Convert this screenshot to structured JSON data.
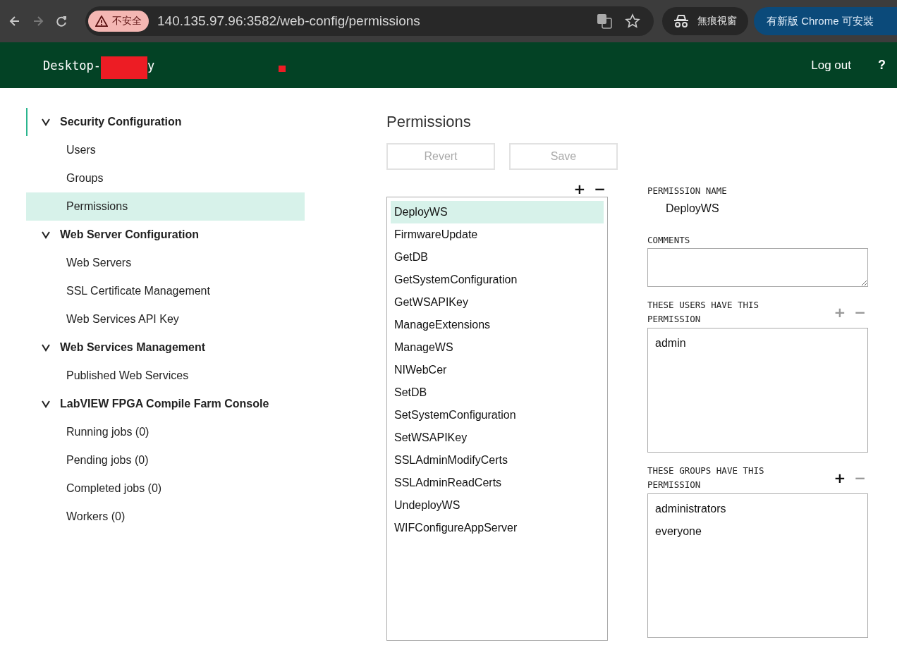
{
  "browser": {
    "security_chip": "不安全",
    "url": "140.135.97.96:3582/web-config/permissions",
    "incognito": "無痕視窗",
    "update": "有新版 Chrome 可安裝"
  },
  "header": {
    "host_prefix": "Desktop-",
    "host_suffix": "y",
    "logout": "Log out",
    "help": "?"
  },
  "sidebar": [
    {
      "label": "Security Configuration",
      "expanded": true,
      "focused": true,
      "children": [
        {
          "label": "Users",
          "selected": false
        },
        {
          "label": "Groups",
          "selected": false
        },
        {
          "label": "Permissions",
          "selected": true
        }
      ]
    },
    {
      "label": "Web Server Configuration",
      "expanded": true,
      "focused": false,
      "children": [
        {
          "label": "Web Servers",
          "selected": false
        },
        {
          "label": "SSL Certificate Management",
          "selected": false
        },
        {
          "label": "Web Services API Key",
          "selected": false
        }
      ]
    },
    {
      "label": "Web Services Management",
      "expanded": true,
      "focused": false,
      "children": [
        {
          "label": "Published Web Services",
          "selected": false
        }
      ]
    },
    {
      "label": "LabVIEW FPGA Compile Farm Console",
      "expanded": true,
      "focused": false,
      "children": [
        {
          "label": "Running jobs (0)",
          "selected": false
        },
        {
          "label": "Pending jobs (0)",
          "selected": false
        },
        {
          "label": "Completed jobs (0)",
          "selected": false
        },
        {
          "label": "Workers (0)",
          "selected": false
        }
      ]
    }
  ],
  "main": {
    "title": "Permissions",
    "buttons": [
      {
        "label": "Revert",
        "disabled": true
      },
      {
        "label": "Save",
        "disabled": true
      }
    ],
    "list_tools": [
      {
        "label": "+",
        "disabled": false
      },
      {
        "label": "−",
        "disabled": false
      }
    ],
    "permissions": [
      {
        "label": "DeployWS",
        "selected": true
      },
      {
        "label": "FirmwareUpdate",
        "selected": false
      },
      {
        "label": "GetDB",
        "selected": false
      },
      {
        "label": "GetSystemConfiguration",
        "selected": false
      },
      {
        "label": "GetWSAPIKey",
        "selected": false
      },
      {
        "label": "ManageExtensions",
        "selected": false
      },
      {
        "label": "ManageWS",
        "selected": false
      },
      {
        "label": "NIWebCer",
        "selected": false
      },
      {
        "label": "SetDB",
        "selected": false
      },
      {
        "label": "SetSystemConfiguration",
        "selected": false
      },
      {
        "label": "SetWSAPIKey",
        "selected": false
      },
      {
        "label": "SSLAdminModifyCerts",
        "selected": false
      },
      {
        "label": "SSLAdminReadCerts",
        "selected": false
      },
      {
        "label": "UndeployWS",
        "selected": false
      },
      {
        "label": "WIFConfigureAppServer",
        "selected": false
      }
    ]
  },
  "details": {
    "name_label": "PERMISSION NAME",
    "name": "DeployWS",
    "comments_label": "COMMENTS",
    "users": {
      "label": "THESE USERS HAVE THIS PERMISSION",
      "tools": [
        {
          "label": "+",
          "disabled": true
        },
        {
          "label": "−",
          "disabled": true
        }
      ],
      "items": [
        "admin"
      ]
    },
    "groups": {
      "label": "THESE GROUPS HAVE THIS PERMISSION",
      "tools": [
        {
          "label": "+",
          "disabled": false
        },
        {
          "label": "−",
          "disabled": true
        }
      ],
      "items": [
        "administrators",
        "everyone"
      ]
    }
  }
}
